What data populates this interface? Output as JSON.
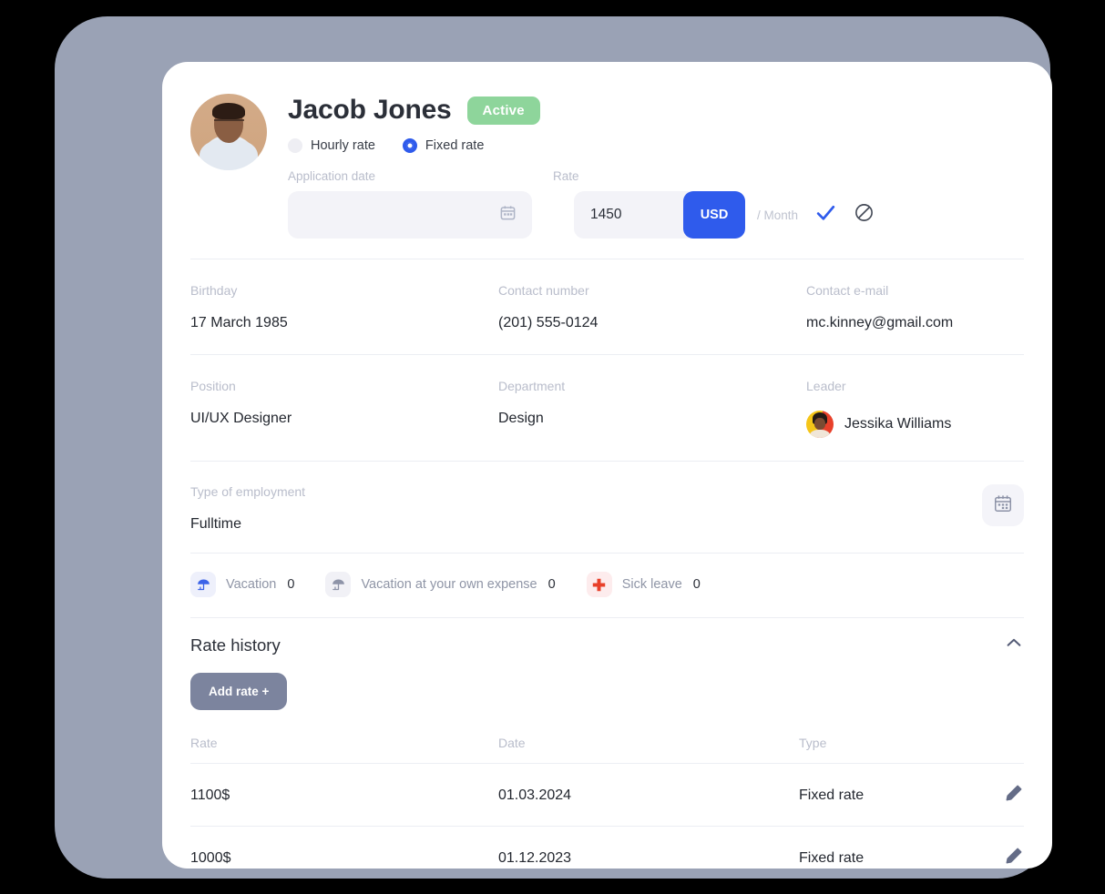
{
  "employee": {
    "name": "Jacob Jones",
    "status": "Active",
    "avatar_icon": "user-photo-avatar"
  },
  "rate_selector": {
    "options": [
      {
        "label": "Hourly rate",
        "selected": false
      },
      {
        "label": "Fixed rate",
        "selected": true
      }
    ]
  },
  "rate_form": {
    "application_date_label": "Application date",
    "application_date_value": "",
    "application_date_placeholder": "",
    "calendar_icon": "calendar-icon",
    "rate_label": "Rate",
    "rate_value": "1450",
    "currency": "USD",
    "period": "/ Month",
    "confirm_icon": "check-icon",
    "cancel_icon": "ban-circle-slash-icon",
    "accent_color": "#2f5bec"
  },
  "contact": {
    "birthday_label": "Birthday",
    "birthday_value": "17 March 1985",
    "phone_label": "Contact number",
    "phone_value": "(201) 555-0124",
    "email_label": "Contact e-mail",
    "email_value": "mc.kinney@gmail.com"
  },
  "job": {
    "position_label": "Position",
    "position_value": "UI/UX Designer",
    "department_label": "Department",
    "department_value": "Design",
    "leader_label": "Leader",
    "leader_value": "Jessika Williams",
    "leader_avatar_icon": "leader-photo-avatar"
  },
  "employment": {
    "type_label": "Type of employment",
    "type_value": "Fulltime",
    "calendar_button_icon": "calendar-icon"
  },
  "leaves": [
    {
      "icon": "beach-umbrella-icon",
      "label": "Vacation",
      "count": "0",
      "tone": "blue"
    },
    {
      "icon": "beach-umbrella-icon",
      "label": "Vacation at your own expense",
      "count": "0",
      "tone": "gray"
    },
    {
      "icon": "medical-cross-icon",
      "label": "Sick leave",
      "count": "0",
      "tone": "red"
    }
  ],
  "rate_history": {
    "title": "Rate history",
    "collapse_icon": "chevron-up-icon",
    "add_button": "Add rate +",
    "columns": [
      "Rate",
      "Date",
      "Type"
    ],
    "rows": [
      {
        "rate": "1100$",
        "date": "01.03.2024",
        "type": "Fixed rate",
        "edit_icon": "pencil-edit-icon"
      },
      {
        "rate": "1000$",
        "date": "01.12.2023",
        "type": "Fixed rate",
        "edit_icon": "pencil-edit-icon"
      }
    ]
  },
  "theme": {
    "frame_color": "#9aa2b5",
    "card_color": "#ffffff",
    "badge_green": "#8ed59b",
    "accent_blue": "#2f5bec",
    "slate": "#7c849e",
    "red": "#e8402a"
  }
}
